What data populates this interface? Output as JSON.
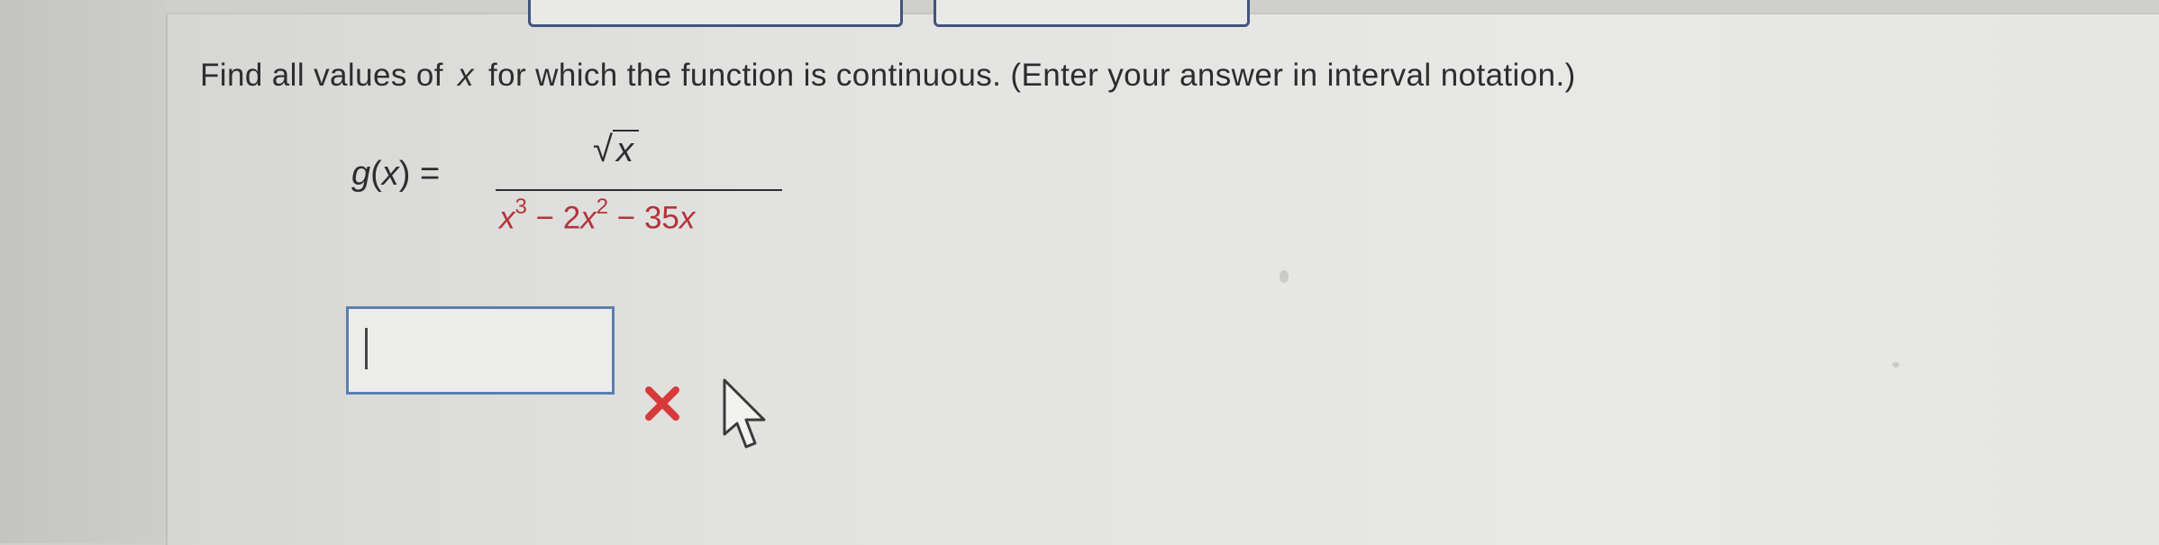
{
  "question": {
    "prefix": "Find all values of",
    "variable": "x",
    "suffix": "for which the function is continuous. (Enter your answer in interval notation.)"
  },
  "equation": {
    "function_label": "g",
    "argument": "x",
    "equals": "=",
    "numerator_radicand": "x",
    "denominator_parts": [
      {
        "base": "x",
        "exp": "3"
      },
      {
        "op": " − 2"
      },
      {
        "base": "x",
        "exp": "2"
      },
      {
        "op": " − 35"
      },
      {
        "base": "x",
        "exp": ""
      }
    ]
  },
  "answer": {
    "value": "",
    "status": "incorrect"
  },
  "colors": {
    "denominator_text": "#b2343a",
    "input_border": "#5b7fb0",
    "wrong_mark": "#d83a3a",
    "tab_border": "#41557a"
  },
  "icons": {
    "status": "wrong-x-icon",
    "pointer": "arrow-cursor-icon"
  }
}
